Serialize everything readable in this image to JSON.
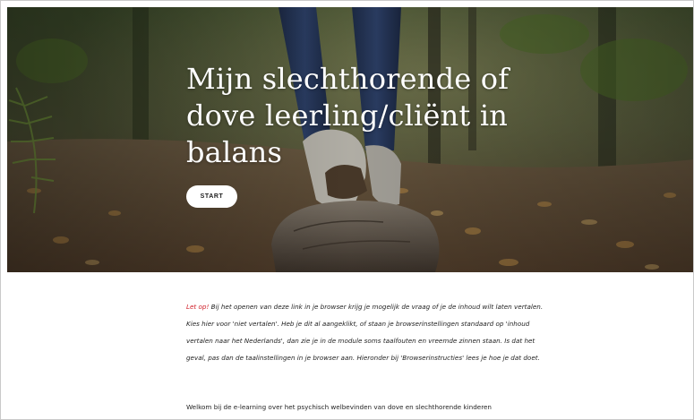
{
  "hero": {
    "title": "Mijn slechthorende of dove leerling/cliënt in balans",
    "start_label": "START"
  },
  "notice": {
    "warning_label": "Let op!",
    "text": " Bij het openen van deze link in je browser krijg je mogelijk de vraag of je de inhoud wilt laten vertalen. Kies hier voor 'niet vertalen'. Heb je dit al aangeklikt, of staan je browserinstellingen standaard op 'inhoud vertalen naar het Nederlands', dan zie je in de module soms taalfouten en vreemde zinnen staan. Is dat het geval, pas dan de taalinstellingen in je browser aan. Hieronder bij 'Browserinstructies' lees je hoe je dat doet."
  },
  "intro": {
    "text": "Welkom bij de e-learning over het psychisch welbevinden van dove en slechthorende kinderen"
  },
  "colors": {
    "warning": "#d0202a",
    "text": "#1f1f1f",
    "button_bg": "#ffffff"
  }
}
